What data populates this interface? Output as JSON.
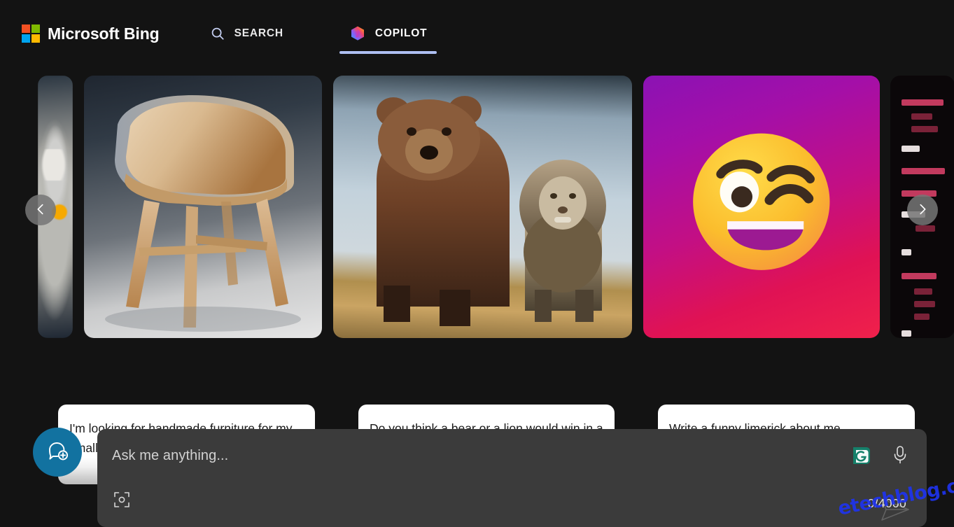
{
  "header": {
    "brand_name": "Microsoft Bing",
    "logo_icon": "microsoft-logo-icon",
    "logo_colors": [
      "#f25022",
      "#7fba00",
      "#00a4ef",
      "#ffb900"
    ],
    "tabs": [
      {
        "label": "SEARCH",
        "icon": "search-icon",
        "active": false
      },
      {
        "label": "COPILOT",
        "icon": "copilot-icon",
        "active": true
      }
    ],
    "active_tab_underline_color": "#aebff2"
  },
  "carousel": {
    "prev_label": "‹",
    "next_label": "›",
    "prev_icon": "chevron-left-icon",
    "next_icon": "chevron-right-icon",
    "cards": [
      {
        "id": "card-edge-left",
        "image_alt": "kitchen-appliance-photo",
        "caption": "",
        "partial": true
      },
      {
        "id": "card-1",
        "image_alt": "wooden-armchair-photo",
        "caption": "I'm looking for handmade furniture for my small apartment",
        "partial": false
      },
      {
        "id": "card-2",
        "image_alt": "bear-and-lion-photo",
        "caption": "Do you think a bear or a lion would win in a fight?",
        "partial": false
      },
      {
        "id": "card-3",
        "image_alt": "winking-emoji-graphic",
        "caption": "Write a funny limerick about me",
        "partial": false
      },
      {
        "id": "card-edge-right",
        "image_alt": "source-code-photo",
        "caption": "",
        "partial": true,
        "code_lines": [
          "struc",
          ";",
          "s",
          ");",
          "struc",
          "void",
          "Ne",
          "'",
          "}",
          "void",
          ";",
          "s",
          "e",
          "{",
          "]"
        ]
      }
    ]
  },
  "composer": {
    "new_chat_icon": "new-chat-bubble-icon",
    "new_chat_color": "#1272a0",
    "placeholder": "Ask me anything...",
    "input_value": "",
    "visual_search_icon": "visual-search-camera-icon",
    "grammarly_icon": "grammarly-icon",
    "grammarly_color": "#15806a",
    "mic_icon": "microphone-icon",
    "send_icon": "send-paper-plane-icon",
    "counter": "0/4000"
  },
  "watermark": {
    "text": "etechblog.cz",
    "color": "#1e33ee"
  }
}
